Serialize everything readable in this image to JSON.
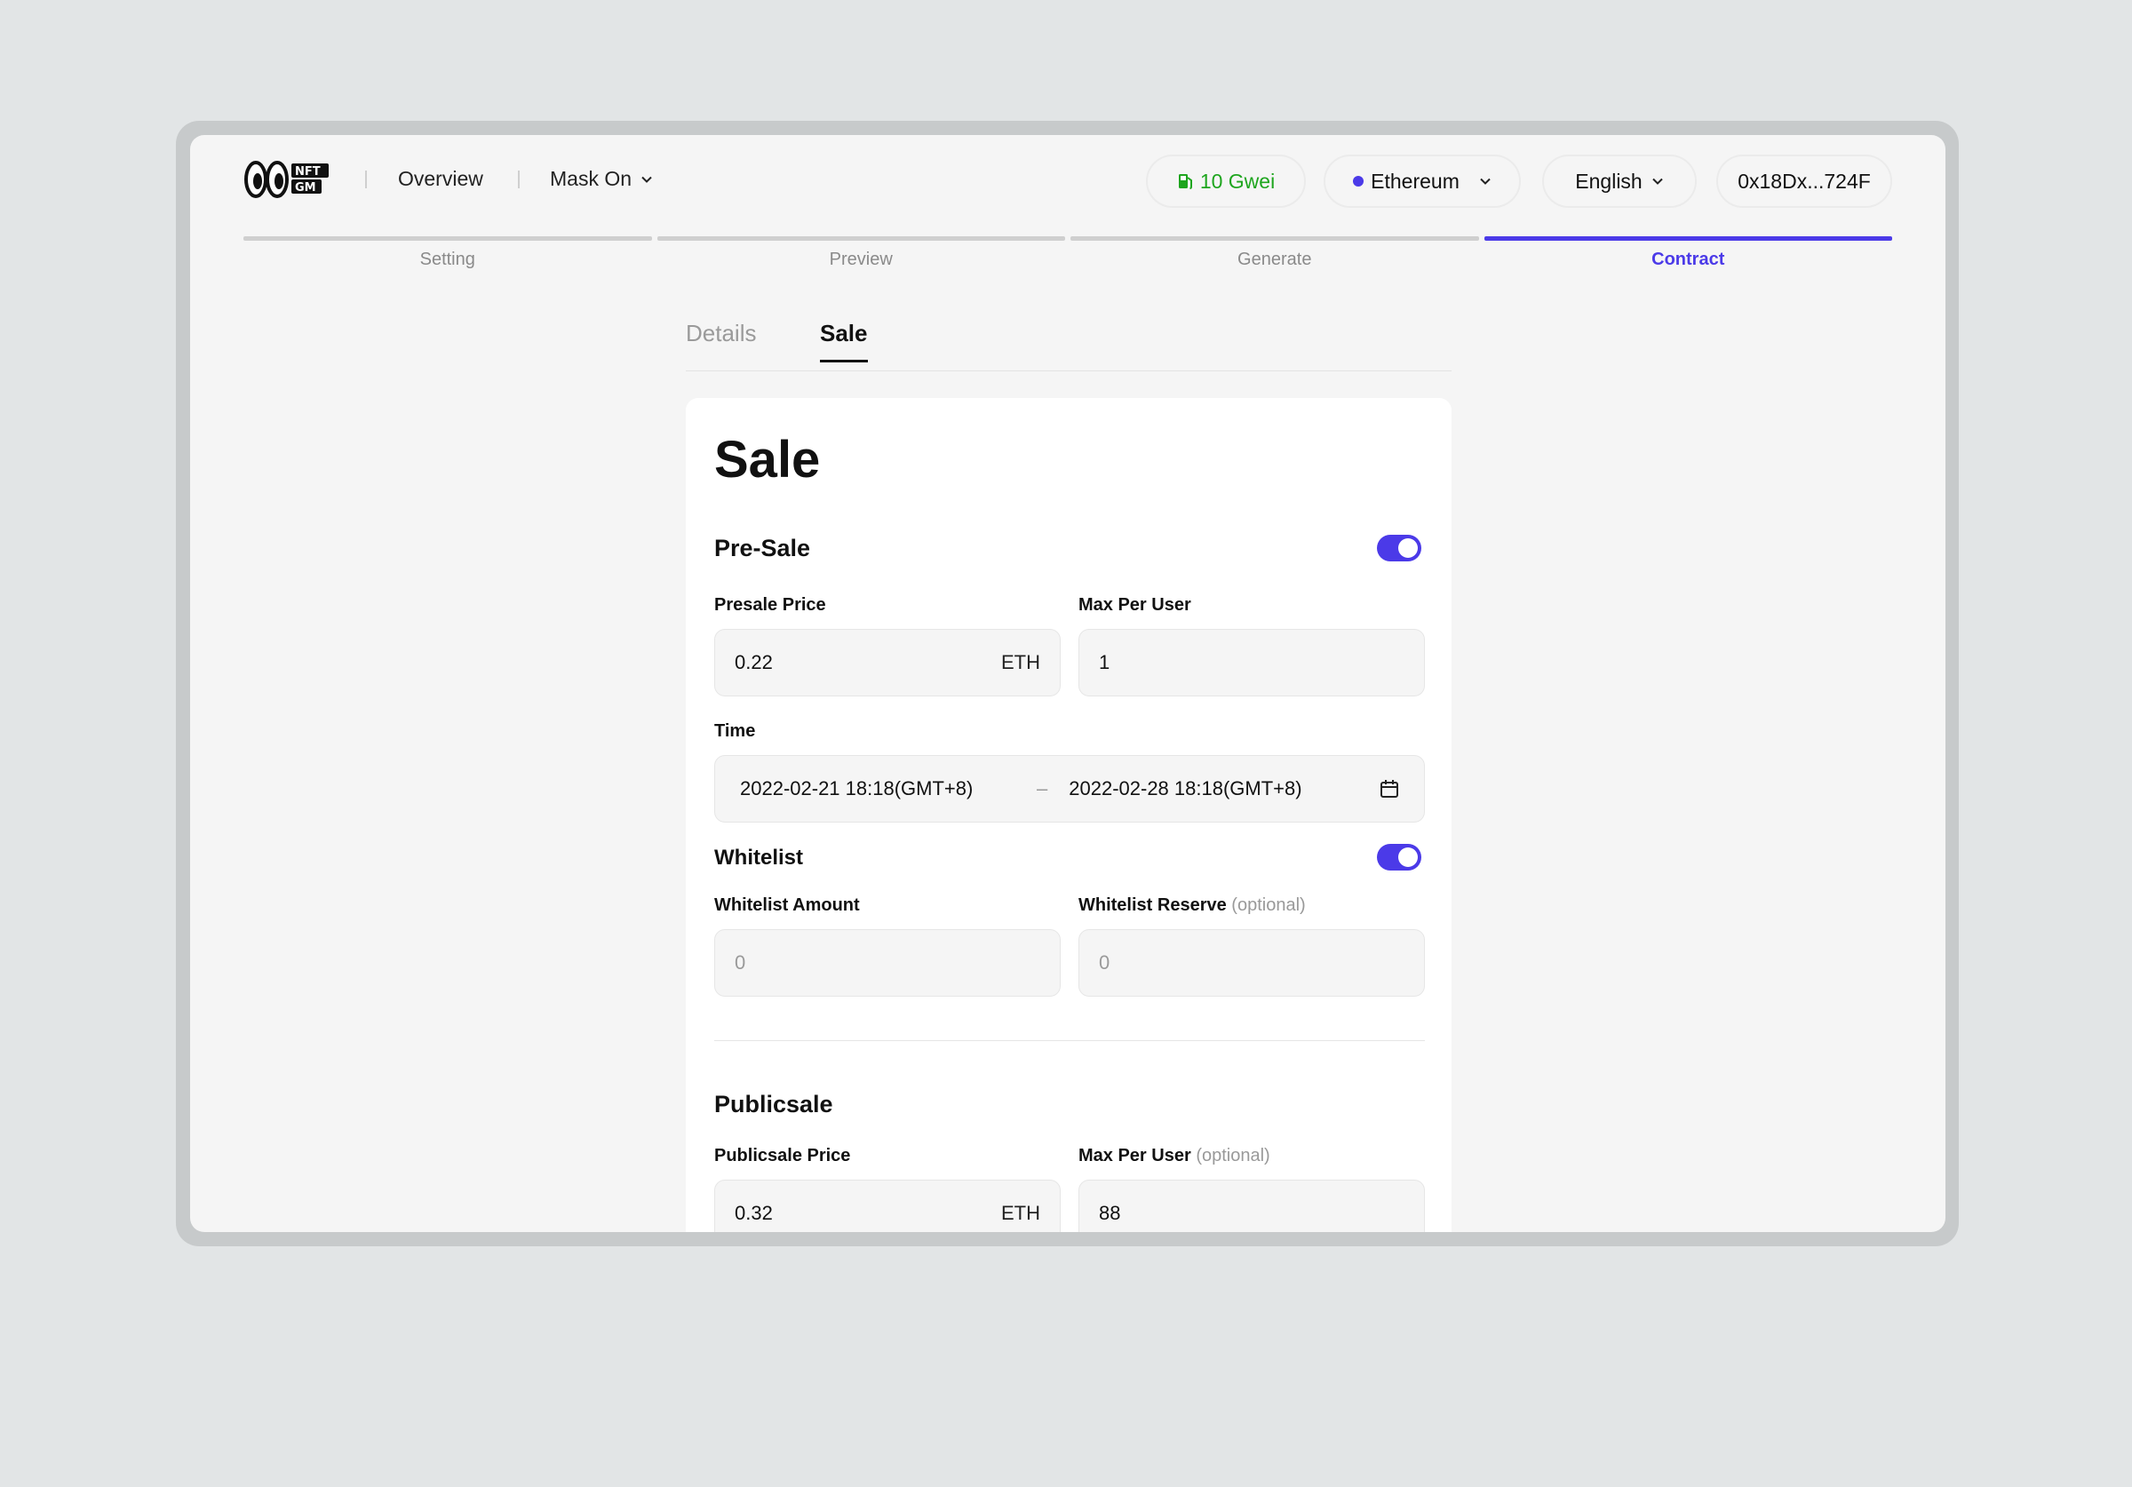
{
  "header": {
    "nav": {
      "overview": "Overview",
      "mask": "Mask On"
    },
    "gas": "10 Gwei",
    "network": "Ethereum",
    "language": "English",
    "wallet": "0x18Dx...724F"
  },
  "steps": [
    {
      "label": "Setting",
      "active": false
    },
    {
      "label": "Preview",
      "active": false
    },
    {
      "label": "Generate",
      "active": false
    },
    {
      "label": "Contract",
      "active": true
    }
  ],
  "tabs": {
    "details": "Details",
    "sale": "Sale"
  },
  "card": {
    "title": "Sale",
    "presale": {
      "title": "Pre-Sale",
      "enabled": true,
      "price_label": "Presale Price",
      "price_value": "0.22",
      "price_unit": "ETH",
      "max_label": "Max Per User",
      "max_value": "1",
      "time_label": "Time",
      "time_start": "2022-02-21 18:18(GMT+8)",
      "time_sep": "–",
      "time_end": "2022-02-28 18:18(GMT+8)"
    },
    "whitelist": {
      "title": "Whitelist",
      "enabled": true,
      "amount_label": "Whitelist Amount",
      "amount_placeholder": "0",
      "reserve_label": "Whitelist Reserve",
      "reserve_optional": "(optional)",
      "reserve_placeholder": "0"
    },
    "publicsale": {
      "title": "Publicsale",
      "price_label": "Publicsale Price",
      "price_value": "0.32",
      "price_unit": "ETH",
      "max_label": "Max Per User",
      "max_optional": "(optional)",
      "max_value": "88"
    }
  },
  "colors": {
    "accent": "#4b3ae8",
    "gas": "#1ea51e"
  },
  "icons": [
    "logo-icon",
    "chevron-down-icon",
    "gas-pump-icon",
    "network-dot-icon",
    "calendar-icon"
  ]
}
